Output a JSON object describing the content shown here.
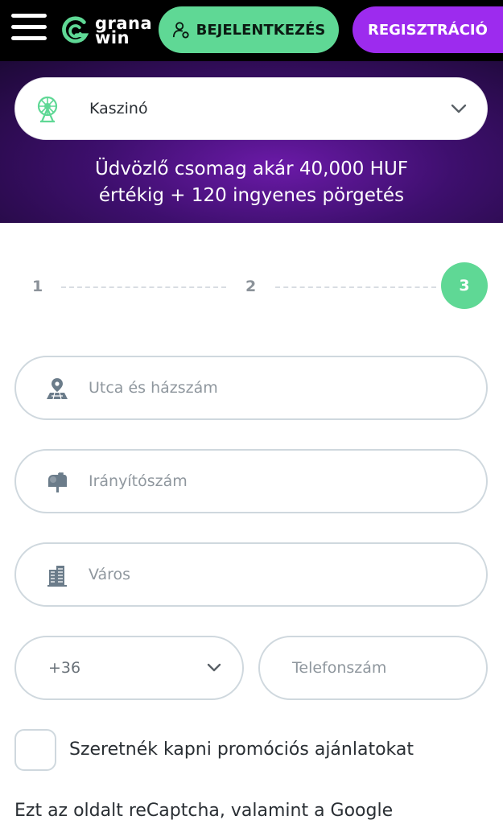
{
  "header": {
    "logo_line1": "grana",
    "logo_line2": "win",
    "login_label": "BEJELENTKEZÉS",
    "register_label": "REGISZTRÁCIÓ"
  },
  "hero": {
    "category_selected": "Kaszinó",
    "promo_line1": "Üdvözlő csomag akár 40,000 HUF",
    "promo_line2": "értékig + 120 ingyenes pörgetés"
  },
  "steps": {
    "step1": "1",
    "step2": "2",
    "step3": "3",
    "active_step": 3
  },
  "form": {
    "street_placeholder": "Utca és házszám",
    "zip_placeholder": "Irányítószám",
    "city_placeholder": "Város",
    "phone_prefix": "+36",
    "phone_placeholder": "Telefonszám",
    "promo_checkbox_label": "Szeretnék kapni promóciós ajánlatokat",
    "recaptcha_text": "Ezt az oldalt reCaptcha, valamint a Google"
  },
  "colors": {
    "accent_green": "#5fd895",
    "accent_purple": "#9d2bee",
    "border": "#cfd8de"
  },
  "icons": {
    "menu": "hamburger-icon",
    "login": "user-icon",
    "category": "ferris-wheel-icon",
    "street": "map-pin-icon",
    "zip": "mailbox-icon",
    "city": "building-icon"
  }
}
